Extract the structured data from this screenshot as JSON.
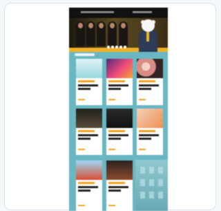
{
  "page": {
    "background": "#f4f8fb",
    "card_border": "#d9e4ee"
  },
  "screenshot": {
    "top_bar": {
      "left_text": "",
      "right_text": ""
    },
    "hero": {
      "slide_count": 5,
      "active_slide": 0,
      "accent": "#f2b127"
    },
    "section_title": "",
    "tiles": [
      {
        "theme": "light-blue",
        "meta": "",
        "title": "",
        "subtitle": ""
      },
      {
        "theme": "purple-orange",
        "meta": "",
        "title": "",
        "subtitle": ""
      },
      {
        "theme": "portrait",
        "meta": "",
        "title": "",
        "subtitle": ""
      },
      {
        "theme": "dark-crowd",
        "meta": "",
        "title": "",
        "subtitle": ""
      },
      {
        "theme": "dark-performer",
        "meta": "",
        "title": "",
        "subtitle": ""
      },
      {
        "theme": "orange-portrait",
        "meta": "",
        "title": "",
        "subtitle": ""
      },
      {
        "theme": "blue-sky",
        "meta": "",
        "title": "",
        "subtitle": ""
      },
      {
        "theme": "stage",
        "meta": "",
        "title": "",
        "subtitle": ""
      }
    ]
  }
}
